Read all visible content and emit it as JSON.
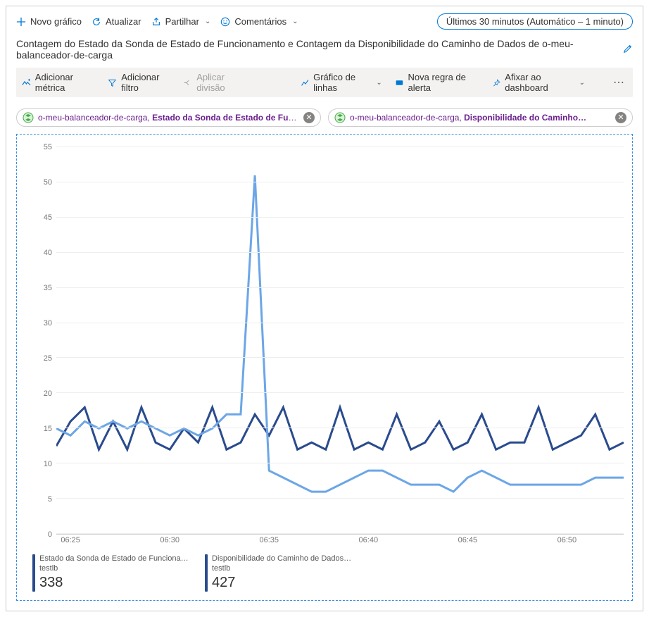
{
  "toolbar_top": {
    "new_chart": "Novo gráfico",
    "refresh": "Atualizar",
    "share": "Partilhar",
    "comments": "Comentários",
    "time_range": "Últimos 30 minutos (Automático – 1 minuto)"
  },
  "title": "Contagem do Estado da Sonda de Estado de Funcionamento e Contagem da Disponibilidade do Caminho de Dados de o-meu-balanceador-de-carga",
  "toolbar_metric": {
    "add_metric": "Adicionar métrica",
    "add_filter": "Adicionar filtro",
    "apply_split": "Aplicar divisão",
    "chart_type": "Gráfico de linhas",
    "new_alert": "Nova regra de alerta",
    "pin": "Afixar ao dashboard"
  },
  "pills": [
    {
      "resource": "o-meu-balanceador-de-carga",
      "metric": "Estado da Sonda de Estado de Funcionamento",
      "agg": "Contagem"
    },
    {
      "resource": "o-meu-balanceador-de-carga",
      "metric": "Disponibilidade do Caminho…",
      "agg": ""
    }
  ],
  "legend": [
    {
      "name": "Estado da Sonda de Estado de Funcionamento…",
      "sub": "testlb",
      "value": "338"
    },
    {
      "name": "Disponibilidade do Caminho de Dados…",
      "sub": "testlb",
      "value": "427"
    }
  ],
  "chart_data": {
    "type": "line",
    "xlabel": "",
    "ylabel": "",
    "ylim": [
      0,
      55
    ],
    "y_ticks": [
      0,
      5,
      10,
      15,
      20,
      25,
      30,
      35,
      40,
      45,
      50,
      55
    ],
    "x_ticks": [
      "06:25",
      "06:30",
      "06:35",
      "06:40",
      "06:45",
      "06:50"
    ],
    "x": [
      0,
      1,
      2,
      3,
      4,
      5,
      6,
      7,
      8,
      9,
      10,
      11,
      12,
      13,
      14,
      15,
      16,
      17,
      18,
      19,
      20,
      21,
      22,
      23,
      24,
      25,
      26,
      27,
      28,
      29,
      30,
      31,
      32,
      33,
      34,
      35,
      36,
      37,
      38,
      39,
      40
    ],
    "series": [
      {
        "name": "Estado da Sonda de Estado de Funcionamento",
        "color": "#2a4b8d",
        "values": [
          12.5,
          16,
          18,
          12,
          16,
          12,
          18,
          13,
          12,
          15,
          13,
          18,
          12,
          13,
          17,
          14,
          18,
          12,
          13,
          12,
          18,
          12,
          13,
          12,
          17,
          12,
          13,
          16,
          12,
          13,
          17,
          12,
          13,
          13,
          18,
          12,
          13,
          14,
          17,
          12,
          13
        ]
      },
      {
        "name": "Disponibilidade do Caminho de Dados",
        "color": "#6ca6e6",
        "values": [
          15,
          14,
          16,
          15,
          16,
          15,
          16,
          15,
          14,
          15,
          14,
          15,
          17,
          17,
          51,
          9,
          8,
          7,
          6,
          6,
          7,
          8,
          9,
          9,
          8,
          7,
          7,
          7,
          6,
          8,
          9,
          8,
          7,
          7,
          7,
          7,
          7,
          7,
          8,
          8,
          8
        ]
      }
    ]
  }
}
